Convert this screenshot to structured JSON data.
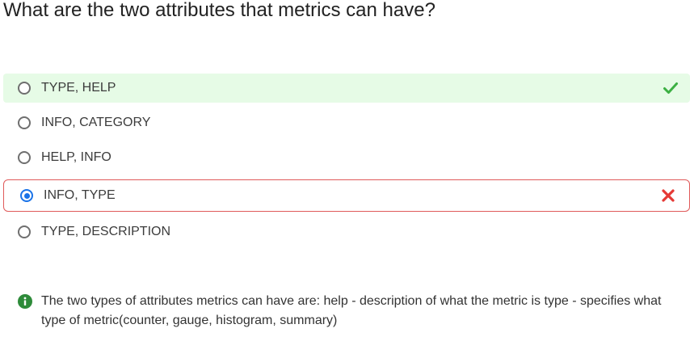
{
  "question": "What are the two attributes that metrics can have?",
  "options": [
    {
      "label": "TYPE, HELP",
      "state": "correct"
    },
    {
      "label": "INFO, CATEGORY",
      "state": "none"
    },
    {
      "label": "HELP, INFO",
      "state": "none"
    },
    {
      "label": "INFO, TYPE",
      "state": "selected-wrong"
    },
    {
      "label": "TYPE, DESCRIPTION",
      "state": "none"
    }
  ],
  "explanation": "The two types of attributes metrics can have are: help - description of what the metric is type - specifies what type of metric(counter, gauge, histogram, summary)",
  "icons": {
    "correct": "check-icon",
    "wrong": "cross-icon",
    "info": "info-icon"
  },
  "colors": {
    "correct_bg": "#e6fbe6",
    "correct_mark": "#3cb043",
    "wrong_border": "#e05a5a",
    "wrong_mark": "#e53935",
    "selected_radio": "#1a73e8",
    "info_icon": "#2e8b3a"
  }
}
